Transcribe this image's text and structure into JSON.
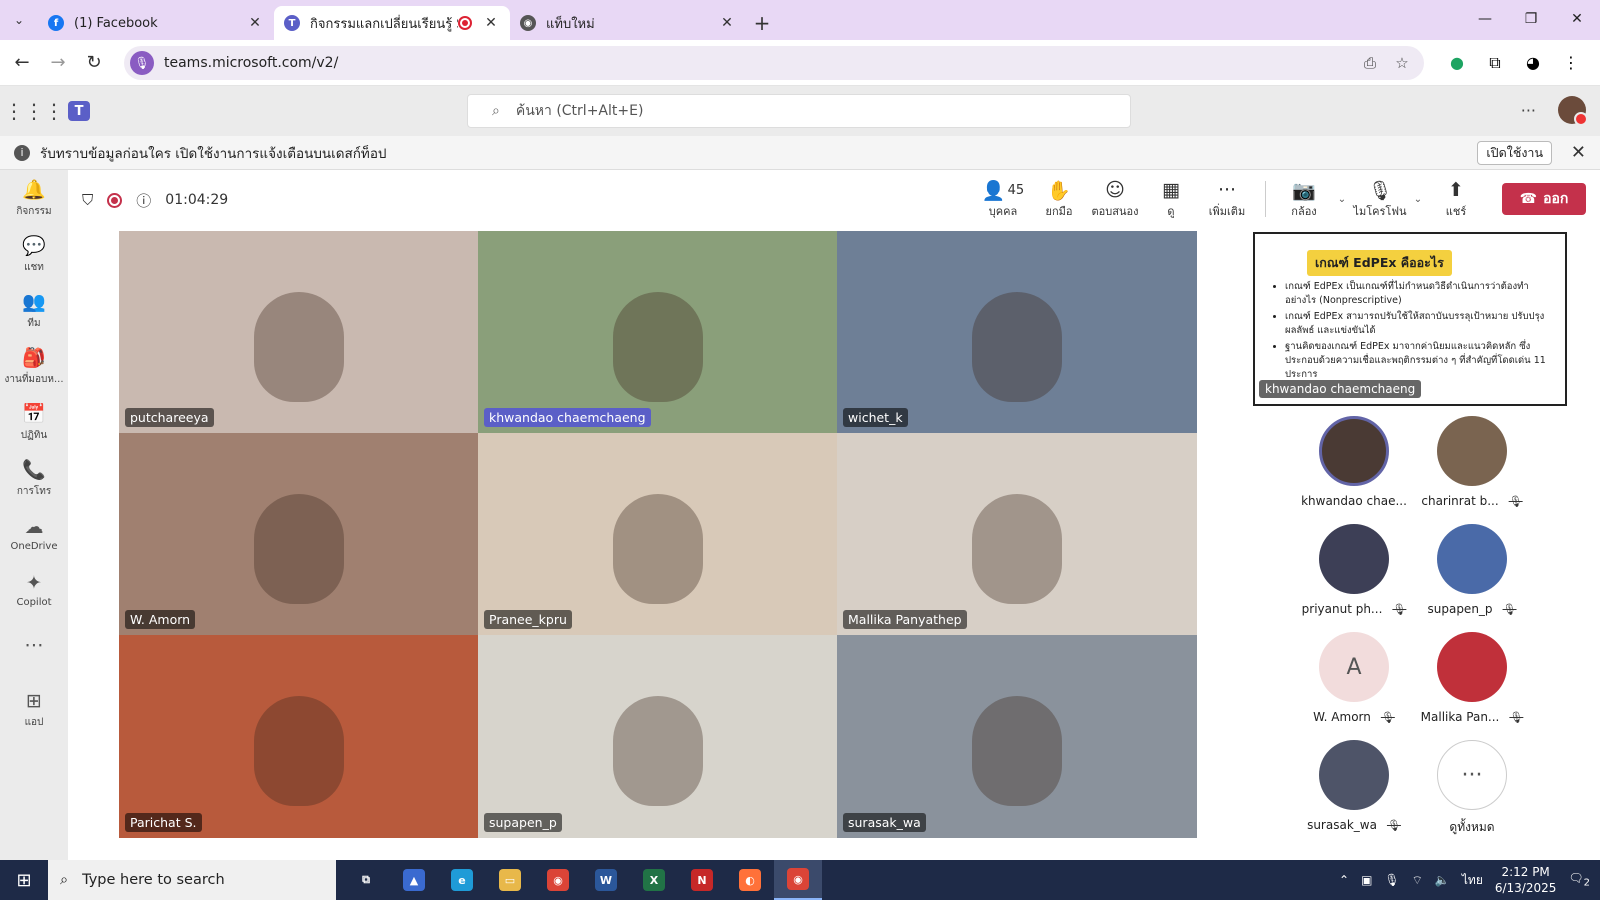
{
  "browser": {
    "tabs": [
      {
        "label": "(1) Facebook",
        "icon": "facebook-icon",
        "color": "#1877f2",
        "active": false
      },
      {
        "label": "กิจกรรมแลกเปลี่ยนเรียนรู้ SAR",
        "icon": "teams-icon",
        "color": "#5b5fc7",
        "active": true
      },
      {
        "label": "แท็บใหม่",
        "icon": "chrome-icon",
        "color": "#555555",
        "active": false
      }
    ],
    "url": "teams.microsoft.com/v2/"
  },
  "teams": {
    "search_placeholder": "ค้นหา (Ctrl+Alt+E)",
    "notice": "รับทราบข้อมูลก่อนใคร เปิดใช้งานการแจ้งเตือนบนเดสก์ท็อป",
    "notice_button": "เปิดใช้งาน",
    "rail": [
      {
        "label": "กิจกรรม",
        "icon": "bell-icon",
        "glyph": "🔔"
      },
      {
        "label": "แชท",
        "icon": "chat-icon",
        "glyph": "💬"
      },
      {
        "label": "ทีม",
        "icon": "teams-group-icon",
        "glyph": "👥"
      },
      {
        "label": "งานที่มอบห...",
        "icon": "assignments-icon",
        "glyph": "🎒"
      },
      {
        "label": "ปฏิทิน",
        "icon": "calendar-icon",
        "glyph": "📅"
      },
      {
        "label": "การโทร",
        "icon": "phone-icon",
        "glyph": "📞"
      },
      {
        "label": "OneDrive",
        "icon": "onedrive-icon",
        "glyph": "☁"
      },
      {
        "label": "Copilot",
        "icon": "copilot-icon",
        "glyph": "✦"
      },
      {
        "label": "",
        "icon": "more-icon",
        "glyph": "⋯"
      },
      {
        "label": "แอป",
        "icon": "apps-add-icon",
        "glyph": "⊞"
      }
    ]
  },
  "meeting": {
    "timer": "01:04:29",
    "people_count": "45",
    "actions": {
      "people": "บุคคล",
      "raise": "ยกมือ",
      "react": "ตอบสนอง",
      "view": "ดู",
      "more": "เพิ่มเติม",
      "camera": "กล้อง",
      "mic": "ไมโครโฟน",
      "share": "แชร์",
      "leave": "ออก"
    },
    "tiles": [
      {
        "name": "putchareeya",
        "bg": "#c9b9b0"
      },
      {
        "name": "khwandao chaemchaeng",
        "bg": "#8a9f7a",
        "highlight": true
      },
      {
        "name": "wichet_k",
        "bg": "#6e7f96"
      },
      {
        "name": "W. Amorn",
        "bg": "#a08070"
      },
      {
        "name": "Pranee_kpru",
        "bg": "#d8c9b8"
      },
      {
        "name": "Mallika Panyathep",
        "bg": "#d7cfc6"
      },
      {
        "name": "Parichat S.",
        "bg": "#b85a3c"
      },
      {
        "name": "supapen_p",
        "bg": "#d7d4cc"
      },
      {
        "name": "surasak_wa",
        "bg": "#8a929c"
      }
    ],
    "shared_content": {
      "title": "เกณฑ์ EdPEx คืออะไร",
      "bullets": [
        "เกณฑ์ EdPEx เป็นเกณฑ์ที่ไม่กำหนดวิธีดำเนินการว่าต้องทำอย่างไร (Nonprescriptive)",
        "เกณฑ์ EdPEx สามารถปรับใช้ให้สถาบันบรรลุเป้าหมาย ปรับปรุงผลลัพธ์ และแข่งขันได้",
        "ฐานคิดของเกณฑ์ EdPEx มาจากค่านิยมและแนวคิดหลัก ซึ่งประกอบด้วยความเชื่อและพฤติกรรมต่าง ๆ ที่สำคัญที่โดดเด่น 11 ประการ"
      ],
      "presenter": "khwandao chaemchaeng"
    },
    "participants": [
      {
        "name": "khwandao chae...",
        "avatar_color": "#4a3a34",
        "ring": true,
        "muted": false
      },
      {
        "name": "charinrat b...",
        "avatar_color": "#7a6450",
        "ring": false,
        "muted": true
      },
      {
        "name": "priyanut ph...",
        "avatar_color": "#3d3f56",
        "ring": false,
        "muted": true
      },
      {
        "name": "supapen_p",
        "avatar_color": "#4a6aa8",
        "ring": false,
        "muted": true
      },
      {
        "name": "W. Amorn",
        "avatar_color": "#f2dcdc",
        "letter": "A",
        "ring": false,
        "muted": true
      },
      {
        "name": "Mallika Pan...",
        "avatar_color": "#c0303a",
        "ring": false,
        "muted": true
      },
      {
        "name": "surasak_wa",
        "avatar_color": "#4e5468",
        "ring": false,
        "muted": true
      },
      {
        "name": "ดูทั้งหมด",
        "avatar_color": "#ffffff",
        "letter": "···",
        "ring": false,
        "muted": false
      }
    ]
  },
  "taskbar": {
    "search_placeholder": "Type here to search",
    "lang": "ไทย",
    "time": "2:12 PM",
    "date": "6/13/2025",
    "notif_count": "2",
    "apps": [
      {
        "icon": "task-view-icon",
        "color": "#1e2a47",
        "glyph": "⧉"
      },
      {
        "icon": "app-icon-blue",
        "color": "#3a6ad0",
        "glyph": "▲"
      },
      {
        "icon": "edge-icon",
        "color": "#1f9bd7",
        "glyph": "e"
      },
      {
        "icon": "file-explorer-icon",
        "color": "#e8b84a",
        "glyph": "▭"
      },
      {
        "icon": "chrome-icon",
        "color": "#db4437",
        "glyph": "◉"
      },
      {
        "icon": "word-icon",
        "color": "#2b579a",
        "glyph": "W"
      },
      {
        "icon": "excel-icon",
        "color": "#217346",
        "glyph": "X"
      },
      {
        "icon": "app-icon-red",
        "color": "#c62828",
        "glyph": "N"
      },
      {
        "icon": "firefox-icon",
        "color": "#ff7139",
        "glyph": "◐"
      },
      {
        "icon": "chrome-icon",
        "color": "#db4437",
        "glyph": "◉",
        "active": true
      }
    ]
  }
}
